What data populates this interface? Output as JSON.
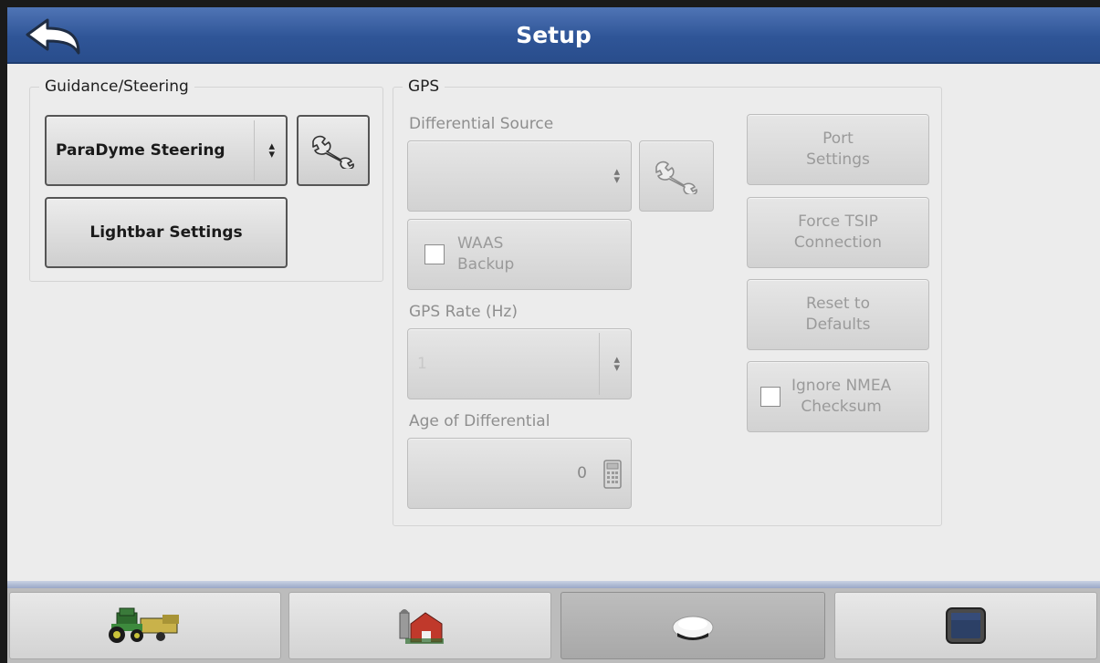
{
  "window": {
    "title": "Setup"
  },
  "guidance": {
    "legend": "Guidance/Steering",
    "steering_select": "ParaDyme Steering",
    "lightbar_button": "Lightbar Settings"
  },
  "gps": {
    "legend": "GPS",
    "differential_source_label": "Differential Source",
    "differential_source_value": "",
    "waas_label_line1": "WAAS",
    "waas_label_line2": "Backup",
    "gps_rate_label": "GPS Rate (Hz)",
    "gps_rate_value": "1",
    "age_label": "Age of Differential",
    "age_value": "0",
    "port_settings_line1": "Port",
    "port_settings_line2": "Settings",
    "force_tsip_line1": "Force TSIP",
    "force_tsip_line2": "Connection",
    "reset_line1": "Reset to",
    "reset_line2": "Defaults",
    "ignore_nmea_line1": "Ignore NMEA",
    "ignore_nmea_line2": "Checksum"
  },
  "footer_tabs": [
    {
      "icon": "tractor-icon",
      "selected": false
    },
    {
      "icon": "farm-icon",
      "selected": false
    },
    {
      "icon": "gps-receiver-icon",
      "selected": true
    },
    {
      "icon": "display-icon",
      "selected": false
    }
  ],
  "colors": {
    "titlebar": "#2f5597",
    "panel": "#ececec",
    "footer": "#bcbcbc"
  }
}
